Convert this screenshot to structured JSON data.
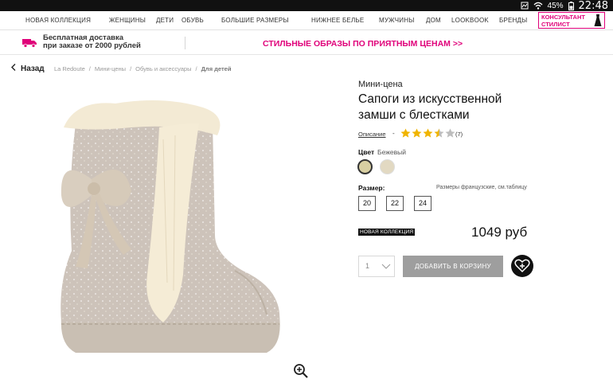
{
  "status_bar": {
    "battery": "45%",
    "time": "22:48"
  },
  "nav": {
    "items": [
      "НОВАЯ КОЛЛЕКЦИЯ",
      "ЖЕНЩИНЫ",
      "ДЕТИ",
      "ОБУВЬ",
      "БОЛЬШИЕ РАЗМЕРЫ",
      "НИЖНЕЕ БЕЛЬЕ",
      "МУЖЧИНЫ",
      "ДОМ",
      "LOOKBOOK",
      "БРЕНДЫ"
    ],
    "consultant_line1": "КОНСУЛЬТАНТ",
    "consultant_line2": "СТИЛИСТ"
  },
  "promo": {
    "shipping_line1": "Бесплатная доставка",
    "shipping_line2": "при заказе от 2000 рублей",
    "link": "СТИЛЬНЫЕ ОБРАЗЫ ПО ПРИЯТНЫМ ЦЕНАМ >>"
  },
  "breadcrumb": {
    "back": "Назад",
    "items": [
      "La Redoute",
      "Мини-цены",
      "Обувь и аксессуары"
    ],
    "current": "Для детей"
  },
  "product": {
    "category": "Мини-цена",
    "title_line1": "Сапоги из искусственной",
    "title_line2": "замши с блестками",
    "description_link": "Описание",
    "separator": "-",
    "rating": 3.5,
    "rating_max": 5,
    "review_count": "(7)",
    "color_label": "Цвет",
    "color_value": "Бежевый",
    "swatches": [
      "#d8cfa2",
      "#e2d9c2"
    ],
    "size_label": "Размер:",
    "size_note": "Размеры французские, см.таблицу",
    "sizes": [
      "20",
      "22",
      "24"
    ],
    "badge": "НОВАЯ КОЛЛЕКЦИЯ",
    "price": "1049 руб",
    "quantity": "1",
    "add_to_cart": "ДОБАВИТЬ В КОРЗИНУ"
  },
  "colors": {
    "accent": "#e0007a",
    "button_gray": "#9e9e9e"
  }
}
